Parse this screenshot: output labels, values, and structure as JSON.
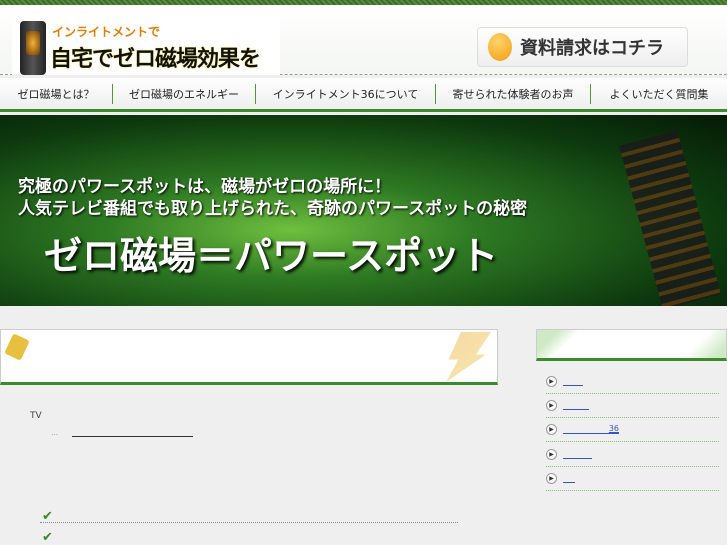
{
  "header": {
    "logo_small": "インライトメントで",
    "logo_big": "自宅でゼロ磁場効果を",
    "request_button": "資料請求はコチラ"
  },
  "nav": [
    {
      "label": "ゼロ磁場とは？"
    },
    {
      "label": "ゼロ磁場のエネルギー"
    },
    {
      "label": "インライトメント36について"
    },
    {
      "label": "寄せられた体験者のお声"
    },
    {
      "label": "よくいただく質問集"
    }
  ],
  "banner": {
    "line1": "究極のパワースポットは、磁場がゼロの場所に！",
    "line2": "人気テレビ番組でも取り上げられた、奇跡のパワースポットの秘密",
    "headline": "ゼロ磁場＝パワースポット"
  },
  "main": {
    "tv_text": "TV",
    "ellipsis": "…"
  },
  "sidebar": {
    "items": [
      {
        "label": ""
      },
      {
        "label": ""
      },
      {
        "label": "36"
      },
      {
        "label": ""
      },
      {
        "label": ""
      }
    ]
  },
  "colors": {
    "accent": "#3c8a2e",
    "link": "#3355cc"
  }
}
